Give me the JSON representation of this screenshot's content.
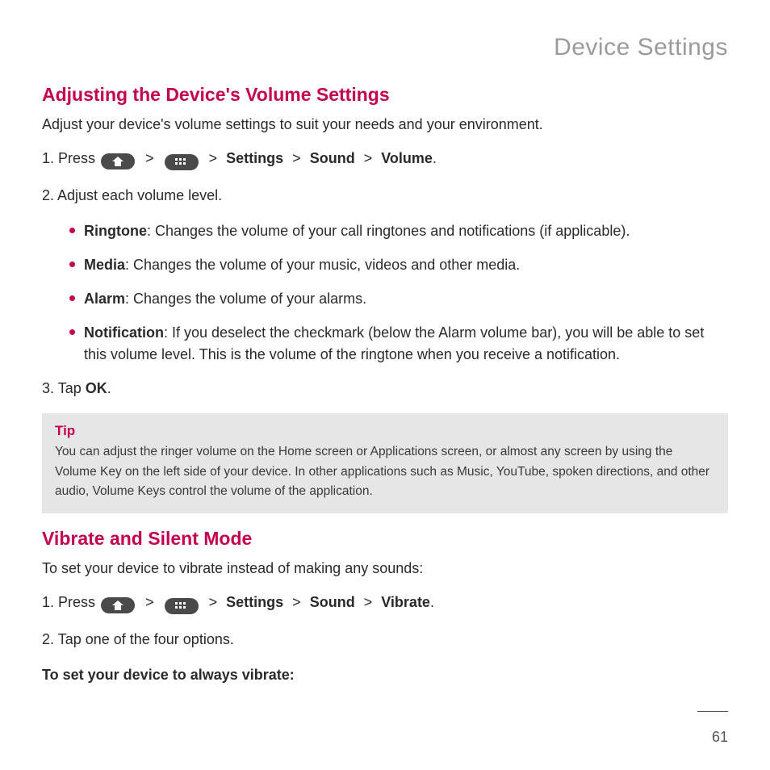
{
  "header": "Device Settings",
  "page_number": "61",
  "section1": {
    "title": "Adjusting the Device's Volume Settings",
    "intro": "Adjust your device's volume settings to suit your needs and your environment.",
    "step1_pre": "1. Press",
    "sep": ">",
    "path": {
      "settings": "Settings",
      "sound": "Sound",
      "volume": "Volume"
    },
    "period": ".",
    "step2": "2. Adjust each volume level.",
    "bullets": [
      {
        "label": "Ringtone",
        "text": ": Changes the volume of your call ringtones and notifications (if applicable)."
      },
      {
        "label": "Media",
        "text": ": Changes the volume of your music, videos and other media."
      },
      {
        "label": "Alarm",
        "text": ": Changes the volume of your alarms."
      },
      {
        "label": "Notification",
        "text": ": If you deselect the checkmark (below the Alarm volume bar), you will be able to set this volume level. This is the volume of the ringtone when you receive a notification."
      }
    ],
    "step3_pre": "3. Tap ",
    "step3_bold": "OK",
    "step3_post": "."
  },
  "tip": {
    "label": "Tip",
    "body": "You can adjust the ringer volume on the Home screen or Applications screen, or almost any screen by using the Volume Key on the left side of your device. In other applications such as Music, YouTube, spoken directions, and other audio, Volume Keys control the volume of the application."
  },
  "section2": {
    "title": "Vibrate and Silent Mode",
    "intro": "To set your device to vibrate instead of making any sounds:",
    "step1_pre": "1. Press",
    "path": {
      "settings": "Settings",
      "sound": "Sound",
      "vibrate": "Vibrate"
    },
    "step2": "2. Tap one of the four options.",
    "sub": "To set your device to always vibrate:"
  }
}
